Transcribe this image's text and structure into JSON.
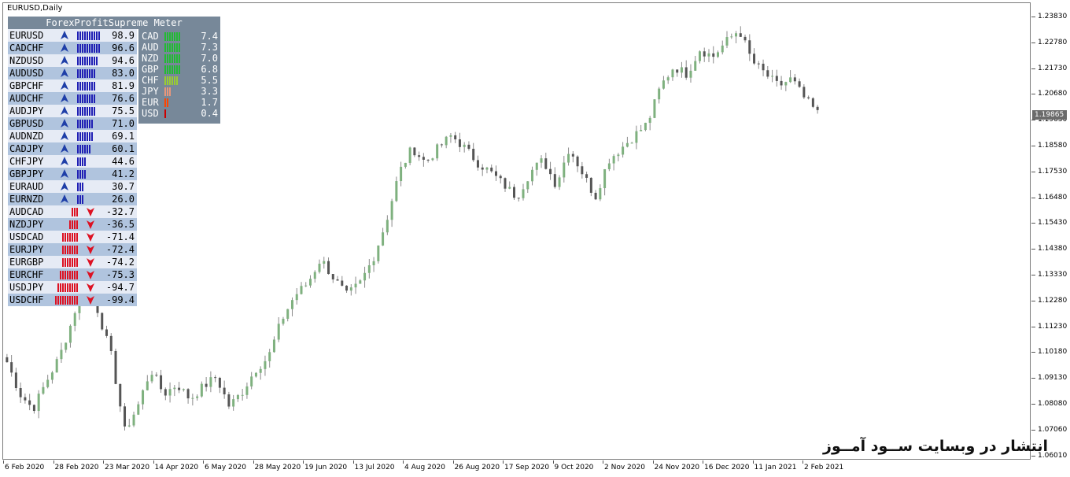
{
  "window": {
    "title": "EURUSD,Daily"
  },
  "meter": {
    "title": "ForexProfitSupreme Meter",
    "pairs": [
      {
        "name": "EURUSD",
        "value": "98.9",
        "strength": 98.9,
        "direction": "up"
      },
      {
        "name": "CADCHF",
        "value": "96.6",
        "strength": 96.6,
        "direction": "up"
      },
      {
        "name": "NZDUSD",
        "value": "94.6",
        "strength": 94.6,
        "direction": "up"
      },
      {
        "name": "AUDUSD",
        "value": "83.0",
        "strength": 83.0,
        "direction": "up"
      },
      {
        "name": "GBPCHF",
        "value": "81.9",
        "strength": 81.9,
        "direction": "up"
      },
      {
        "name": "AUDCHF",
        "value": "76.6",
        "strength": 76.6,
        "direction": "up"
      },
      {
        "name": "AUDJPY",
        "value": "75.5",
        "strength": 75.5,
        "direction": "up"
      },
      {
        "name": "GBPUSD",
        "value": "71.0",
        "strength": 71.0,
        "direction": "up"
      },
      {
        "name": "AUDNZD",
        "value": "69.1",
        "strength": 69.1,
        "direction": "up"
      },
      {
        "name": "CADJPY",
        "value": "60.1",
        "strength": 60.1,
        "direction": "up"
      },
      {
        "name": "CHFJPY",
        "value": "44.6",
        "strength": 44.6,
        "direction": "up"
      },
      {
        "name": "GBPJPY",
        "value": "41.2",
        "strength": 41.2,
        "direction": "up"
      },
      {
        "name": "EURAUD",
        "value": "30.7",
        "strength": 30.7,
        "direction": "up"
      },
      {
        "name": "EURNZD",
        "value": "26.0",
        "strength": 26.0,
        "direction": "up"
      },
      {
        "name": "AUDCAD",
        "value": "-32.7",
        "strength": 32.7,
        "direction": "down"
      },
      {
        "name": "NZDJPY",
        "value": "-36.5",
        "strength": 36.5,
        "direction": "down"
      },
      {
        "name": "USDCAD",
        "value": "-71.4",
        "strength": 71.4,
        "direction": "down"
      },
      {
        "name": "EURJPY",
        "value": "-72.4",
        "strength": 72.4,
        "direction": "down"
      },
      {
        "name": "EURGBP",
        "value": "-74.2",
        "strength": 74.2,
        "direction": "down"
      },
      {
        "name": "EURCHF",
        "value": "-75.3",
        "strength": 75.3,
        "direction": "down"
      },
      {
        "name": "USDJPY",
        "value": "-94.7",
        "strength": 94.7,
        "direction": "down"
      },
      {
        "name": "USDCHF",
        "value": "-99.4",
        "strength": 99.4,
        "direction": "down"
      }
    ],
    "currencies": [
      {
        "name": "CAD",
        "value": "7.4",
        "strength": 7.4,
        "color": "#22bb33"
      },
      {
        "name": "AUD",
        "value": "7.3",
        "strength": 7.3,
        "color": "#22bb33"
      },
      {
        "name": "NZD",
        "value": "7.0",
        "strength": 7.0,
        "color": "#22bb33"
      },
      {
        "name": "GBP",
        "value": "6.8",
        "strength": 6.8,
        "color": "#22bb33"
      },
      {
        "name": "CHF",
        "value": "5.5",
        "strength": 5.5,
        "color": "#9acd32"
      },
      {
        "name": "JPY",
        "value": "3.3",
        "strength": 3.3,
        "color": "#e9967a"
      },
      {
        "name": "EUR",
        "value": "1.7",
        "strength": 1.7,
        "color": "#ff4500"
      },
      {
        "name": "USD",
        "value": "0.4",
        "strength": 0.4,
        "color": "#cc0000"
      }
    ],
    "colors": {
      "up_bars": "#1f1fb4",
      "down_bars": "#dd1122",
      "up_arrow": "#1f3fa8",
      "down_arrow": "#dd1122"
    }
  },
  "price_axis": {
    "labels": [
      "1.23830",
      "1.22780",
      "1.21730",
      "1.20680",
      "1.19630",
      "1.18580",
      "1.17530",
      "1.16480",
      "1.15430",
      "1.14380",
      "1.13330",
      "1.12280",
      "1.11230",
      "1.10180",
      "1.09130",
      "1.08080",
      "1.07060",
      "1.06010"
    ],
    "current": "1.19865"
  },
  "time_axis": {
    "labels": [
      "6 Feb 2020",
      "28 Feb 2020",
      "23 Mar 2020",
      "14 Apr 2020",
      "6 May 2020",
      "28 May 2020",
      "19 Jun 2020",
      "13 Jul 2020",
      "4 Aug 2020",
      "26 Aug 2020",
      "17 Sep 2020",
      "9 Oct 2020",
      "2 Nov 2020",
      "24 Nov 2020",
      "16 Dec 2020",
      "11 Jan 2021",
      "2 Feb 2021"
    ]
  },
  "watermark": "انتشار در وبسایت ســود آمــوز",
  "chart_data": {
    "type": "candlestick",
    "title": "EURUSD,Daily",
    "x": [
      "6 Feb 2020",
      "28 Feb 2020",
      "23 Mar 2020",
      "14 Apr 2020",
      "6 May 2020",
      "28 May 2020",
      "19 Jun 2020",
      "13 Jul 2020",
      "4 Aug 2020",
      "26 Aug 2020",
      "17 Sep 2020",
      "9 Oct 2020",
      "2 Nov 2020",
      "24 Nov 2020",
      "16 Dec 2020",
      "11 Jan 2021",
      "2 Feb 2021"
    ],
    "y_range": [
      1.0601,
      1.2383
    ],
    "current_price": 1.19865,
    "series": [
      {
        "values": [
          1.098,
          1.085,
          1.079,
          1.09,
          1.1,
          1.115,
          1.135,
          1.118,
          1.1,
          1.07,
          1.08,
          1.095,
          1.085,
          1.089,
          1.083,
          1.088,
          1.092,
          1.08,
          1.086,
          1.095,
          1.1,
          1.115,
          1.125,
          1.13,
          1.14,
          1.132,
          1.125,
          1.13,
          1.14,
          1.155,
          1.175,
          1.185,
          1.179,
          1.185,
          1.19,
          1.185,
          1.179,
          1.175,
          1.17,
          1.165,
          1.175,
          1.18,
          1.17,
          1.185,
          1.175,
          1.165,
          1.18,
          1.185,
          1.19,
          1.195,
          1.21,
          1.218,
          1.215,
          1.225,
          1.222,
          1.228,
          1.233,
          1.22,
          1.215,
          1.21,
          1.213,
          1.205,
          1.199
        ]
      }
    ]
  }
}
